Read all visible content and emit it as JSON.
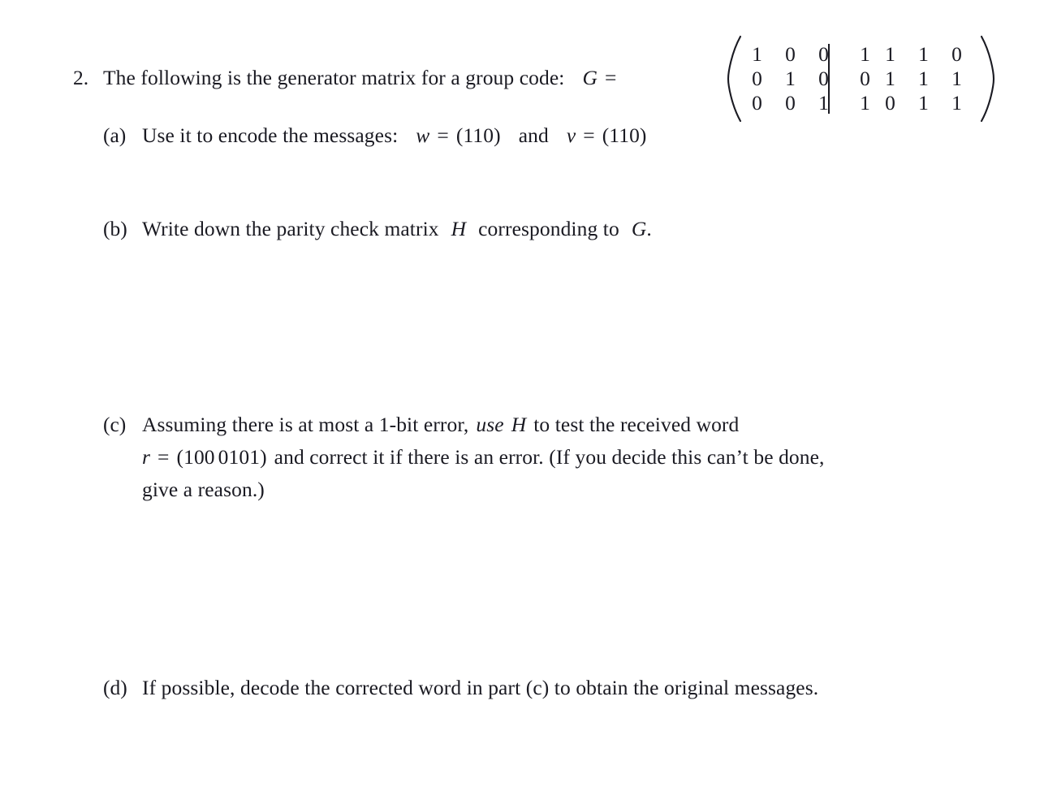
{
  "document": {
    "type": "math-exercise",
    "background_color": "#ffffff",
    "text_color": "#1a1a22"
  },
  "problem": {
    "number": "2.",
    "statement_before_matrix": "The following is the generator matrix for a group code:",
    "matrix_label": "G",
    "equals": "=",
    "matrix": {
      "name": "G",
      "rows": 3,
      "cols": 7,
      "divider_after_col": 3,
      "values": [
        [
          "1",
          "0",
          "0",
          "1",
          "1",
          "1",
          "0"
        ],
        [
          "0",
          "1",
          "0",
          "0",
          "1",
          "1",
          "1"
        ],
        [
          "0",
          "0",
          "1",
          "1",
          "0",
          "1",
          "1"
        ]
      ]
    }
  },
  "parts": [
    {
      "marker": "(a)",
      "lines": [
        {
          "segments": [
            {
              "text": "Use it to encode the messages:",
              "style": "roman"
            },
            {
              "text": "w",
              "style": "math"
            },
            {
              "text": "=",
              "style": "roman"
            },
            {
              "text": "(110)",
              "style": "roman"
            },
            {
              "text": "and",
              "style": "roman"
            },
            {
              "text": "v",
              "style": "math"
            },
            {
              "text": "=",
              "style": "roman"
            },
            {
              "text": "(110)",
              "style": "roman"
            }
          ]
        }
      ]
    },
    {
      "marker": "(b)",
      "lines": [
        {
          "segments": [
            {
              "text": "Write down the parity check matrix",
              "style": "roman"
            },
            {
              "text": "H",
              "style": "math"
            },
            {
              "text": "corresponding to",
              "style": "roman"
            },
            {
              "text": "G",
              "style": "math"
            },
            {
              "text": ".",
              "style": "roman"
            }
          ]
        }
      ]
    },
    {
      "marker": "(c)",
      "lines": [
        {
          "segments": [
            {
              "text": "Assuming there is at most a 1-bit error,",
              "style": "roman"
            },
            {
              "text": "use",
              "style": "italic"
            },
            {
              "text": "H",
              "style": "math"
            },
            {
              "text": "to test the received word",
              "style": "roman"
            }
          ]
        },
        {
          "segments": [
            {
              "text": "r",
              "style": "math"
            },
            {
              "text": "=",
              "style": "roman"
            },
            {
              "text": "(100",
              "style": "roman"
            },
            {
              "text": "0101)",
              "style": "roman"
            },
            {
              "text": "and correct it if there is an error.  (If you decide this can’t be done,",
              "style": "roman"
            }
          ]
        },
        {
          "segments": [
            {
              "text": "give a reason.)",
              "style": "roman"
            }
          ]
        }
      ]
    },
    {
      "marker": "(d)",
      "lines": [
        {
          "segments": [
            {
              "text": "If possible, decode the corrected word in part (c) to obtain the original messages.",
              "style": "roman"
            }
          ]
        }
      ]
    }
  ]
}
